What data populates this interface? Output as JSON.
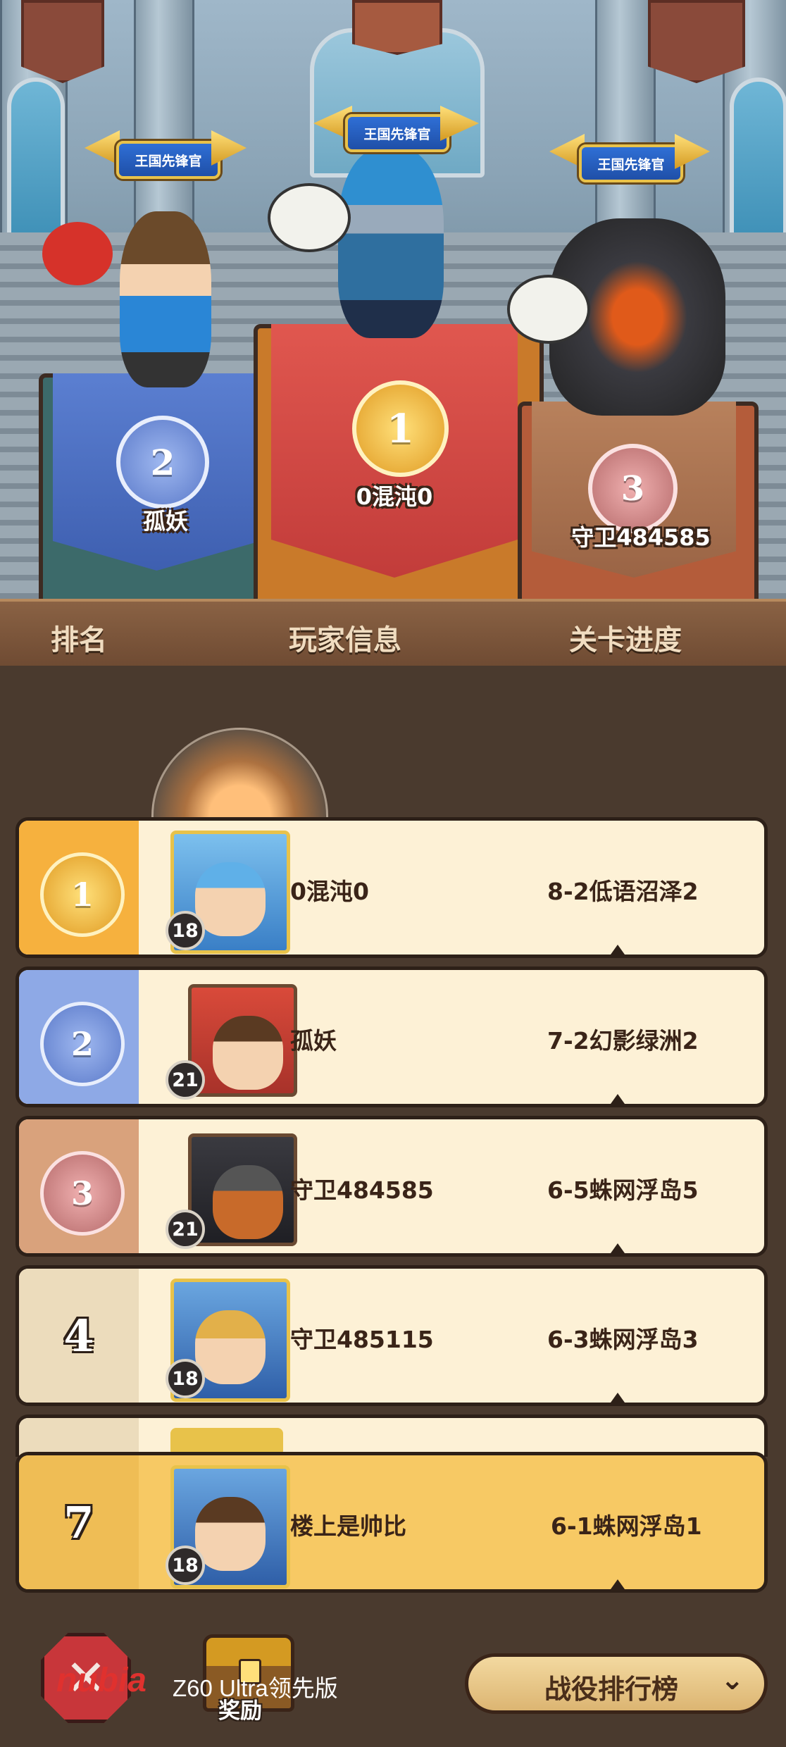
{
  "podium": {
    "title_badge": "王国先锋官",
    "first": {
      "rank": "1",
      "name": "0混沌0"
    },
    "second": {
      "rank": "2",
      "name": "孤妖"
    },
    "third": {
      "rank": "3",
      "name": "守卫484585"
    }
  },
  "columns": {
    "rank": "排名",
    "player": "玩家信息",
    "progress": "关卡进度"
  },
  "rows": [
    {
      "rank": "1",
      "level": "18",
      "name": "0混沌0",
      "progress": "8-2低语沼泽2"
    },
    {
      "rank": "2",
      "level": "21",
      "name": "孤妖",
      "progress": "7-2幻影绿洲2"
    },
    {
      "rank": "3",
      "level": "21",
      "name": "守卫484585",
      "progress": "6-5蛛网浮岛5"
    },
    {
      "rank": "4",
      "level": "18",
      "name": "守卫485115",
      "progress": "6-3蛛网浮岛3"
    }
  ],
  "my_row": {
    "rank": "7",
    "level": "18",
    "name": "楼上是帅比",
    "progress": "6-1蛛网浮岛1"
  },
  "bottom": {
    "reward_label": "奖励",
    "watermark_brand": "nubia",
    "watermark_model": "Z60 Ultra领先版",
    "dropdown_label": "战役排行榜"
  },
  "colors": {
    "rank1": "#f6b13e",
    "rank2": "#8ea9e6",
    "rank3": "#d9a27c",
    "plain": "#ecdcbc",
    "my_row": "#f7c964"
  }
}
